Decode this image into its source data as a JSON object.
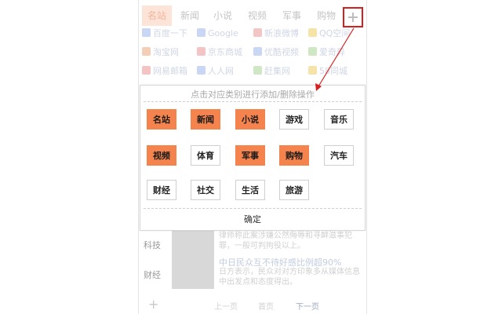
{
  "tabs": [
    "名站",
    "新闻",
    "小说",
    "视频",
    "军事",
    "购物"
  ],
  "active_tab": 0,
  "sites": [
    {
      "label": "百度一下",
      "icon": "baidu-icon",
      "color": "#c9d6f4"
    },
    {
      "label": "Google",
      "icon": "google-icon",
      "color": "#c9d6f4"
    },
    {
      "label": "新浪微博",
      "icon": "weibo-icon",
      "color": "#f3c6c6"
    },
    {
      "label": "QQ空间",
      "icon": "qzone-icon",
      "color": "#f6e3a8"
    },
    {
      "label": "淘宝网",
      "icon": "taobao-icon",
      "color": "#f4cfb8"
    },
    {
      "label": "京东商城",
      "icon": "jd-icon",
      "color": "#f4c4c4"
    },
    {
      "label": "优酷视频",
      "icon": "youku-icon",
      "color": "#c9d6f4"
    },
    {
      "label": "爱奇异",
      "icon": "iqiyi-icon",
      "color": "#cfe7c4"
    },
    {
      "label": "网易邮箱",
      "icon": "netease-icon",
      "color": "#f4c4c4"
    },
    {
      "label": "人人网",
      "icon": "renren-icon",
      "color": "#c9d6f4"
    },
    {
      "label": "赶集网",
      "icon": "ganji-icon",
      "color": "#cfe7c4"
    },
    {
      "label": "58同城",
      "icon": "58-icon",
      "color": "#f6e3a8"
    }
  ],
  "dialog": {
    "hint": "点击对应类别进行添加/删除操作",
    "confirm_label": "确定",
    "categories": [
      {
        "label": "名站",
        "selected": true
      },
      {
        "label": "新闻",
        "selected": true
      },
      {
        "label": "小说",
        "selected": true
      },
      {
        "label": "游戏",
        "selected": false
      },
      {
        "label": "音乐",
        "selected": false
      },
      {
        "label": "视频",
        "selected": true
      },
      {
        "label": "体育",
        "selected": false
      },
      {
        "label": "军事",
        "selected": true
      },
      {
        "label": "购物",
        "selected": true
      },
      {
        "label": "汽车",
        "selected": false
      },
      {
        "label": "财经",
        "selected": false
      },
      {
        "label": "社交",
        "selected": false
      },
      {
        "label": "生活",
        "selected": false
      },
      {
        "label": "旅游",
        "selected": false
      }
    ]
  },
  "news": [
    {
      "category": "科技",
      "title": "",
      "desc": "律师称此案涉嫌公然侮辱和寻衅滋事犯罪，一般可判拘役以上。"
    },
    {
      "category": "财经",
      "title": "中日民众互不待好感比例超90%",
      "desc": "日方表示，民众对对方印象多从媒体信息中出发点和态度得出。"
    }
  ],
  "pager": {
    "prev": "上一页",
    "home": "首页",
    "next": "下一页"
  },
  "colors": {
    "accent": "#f4834d",
    "highlight_border": "#d61f1f"
  }
}
